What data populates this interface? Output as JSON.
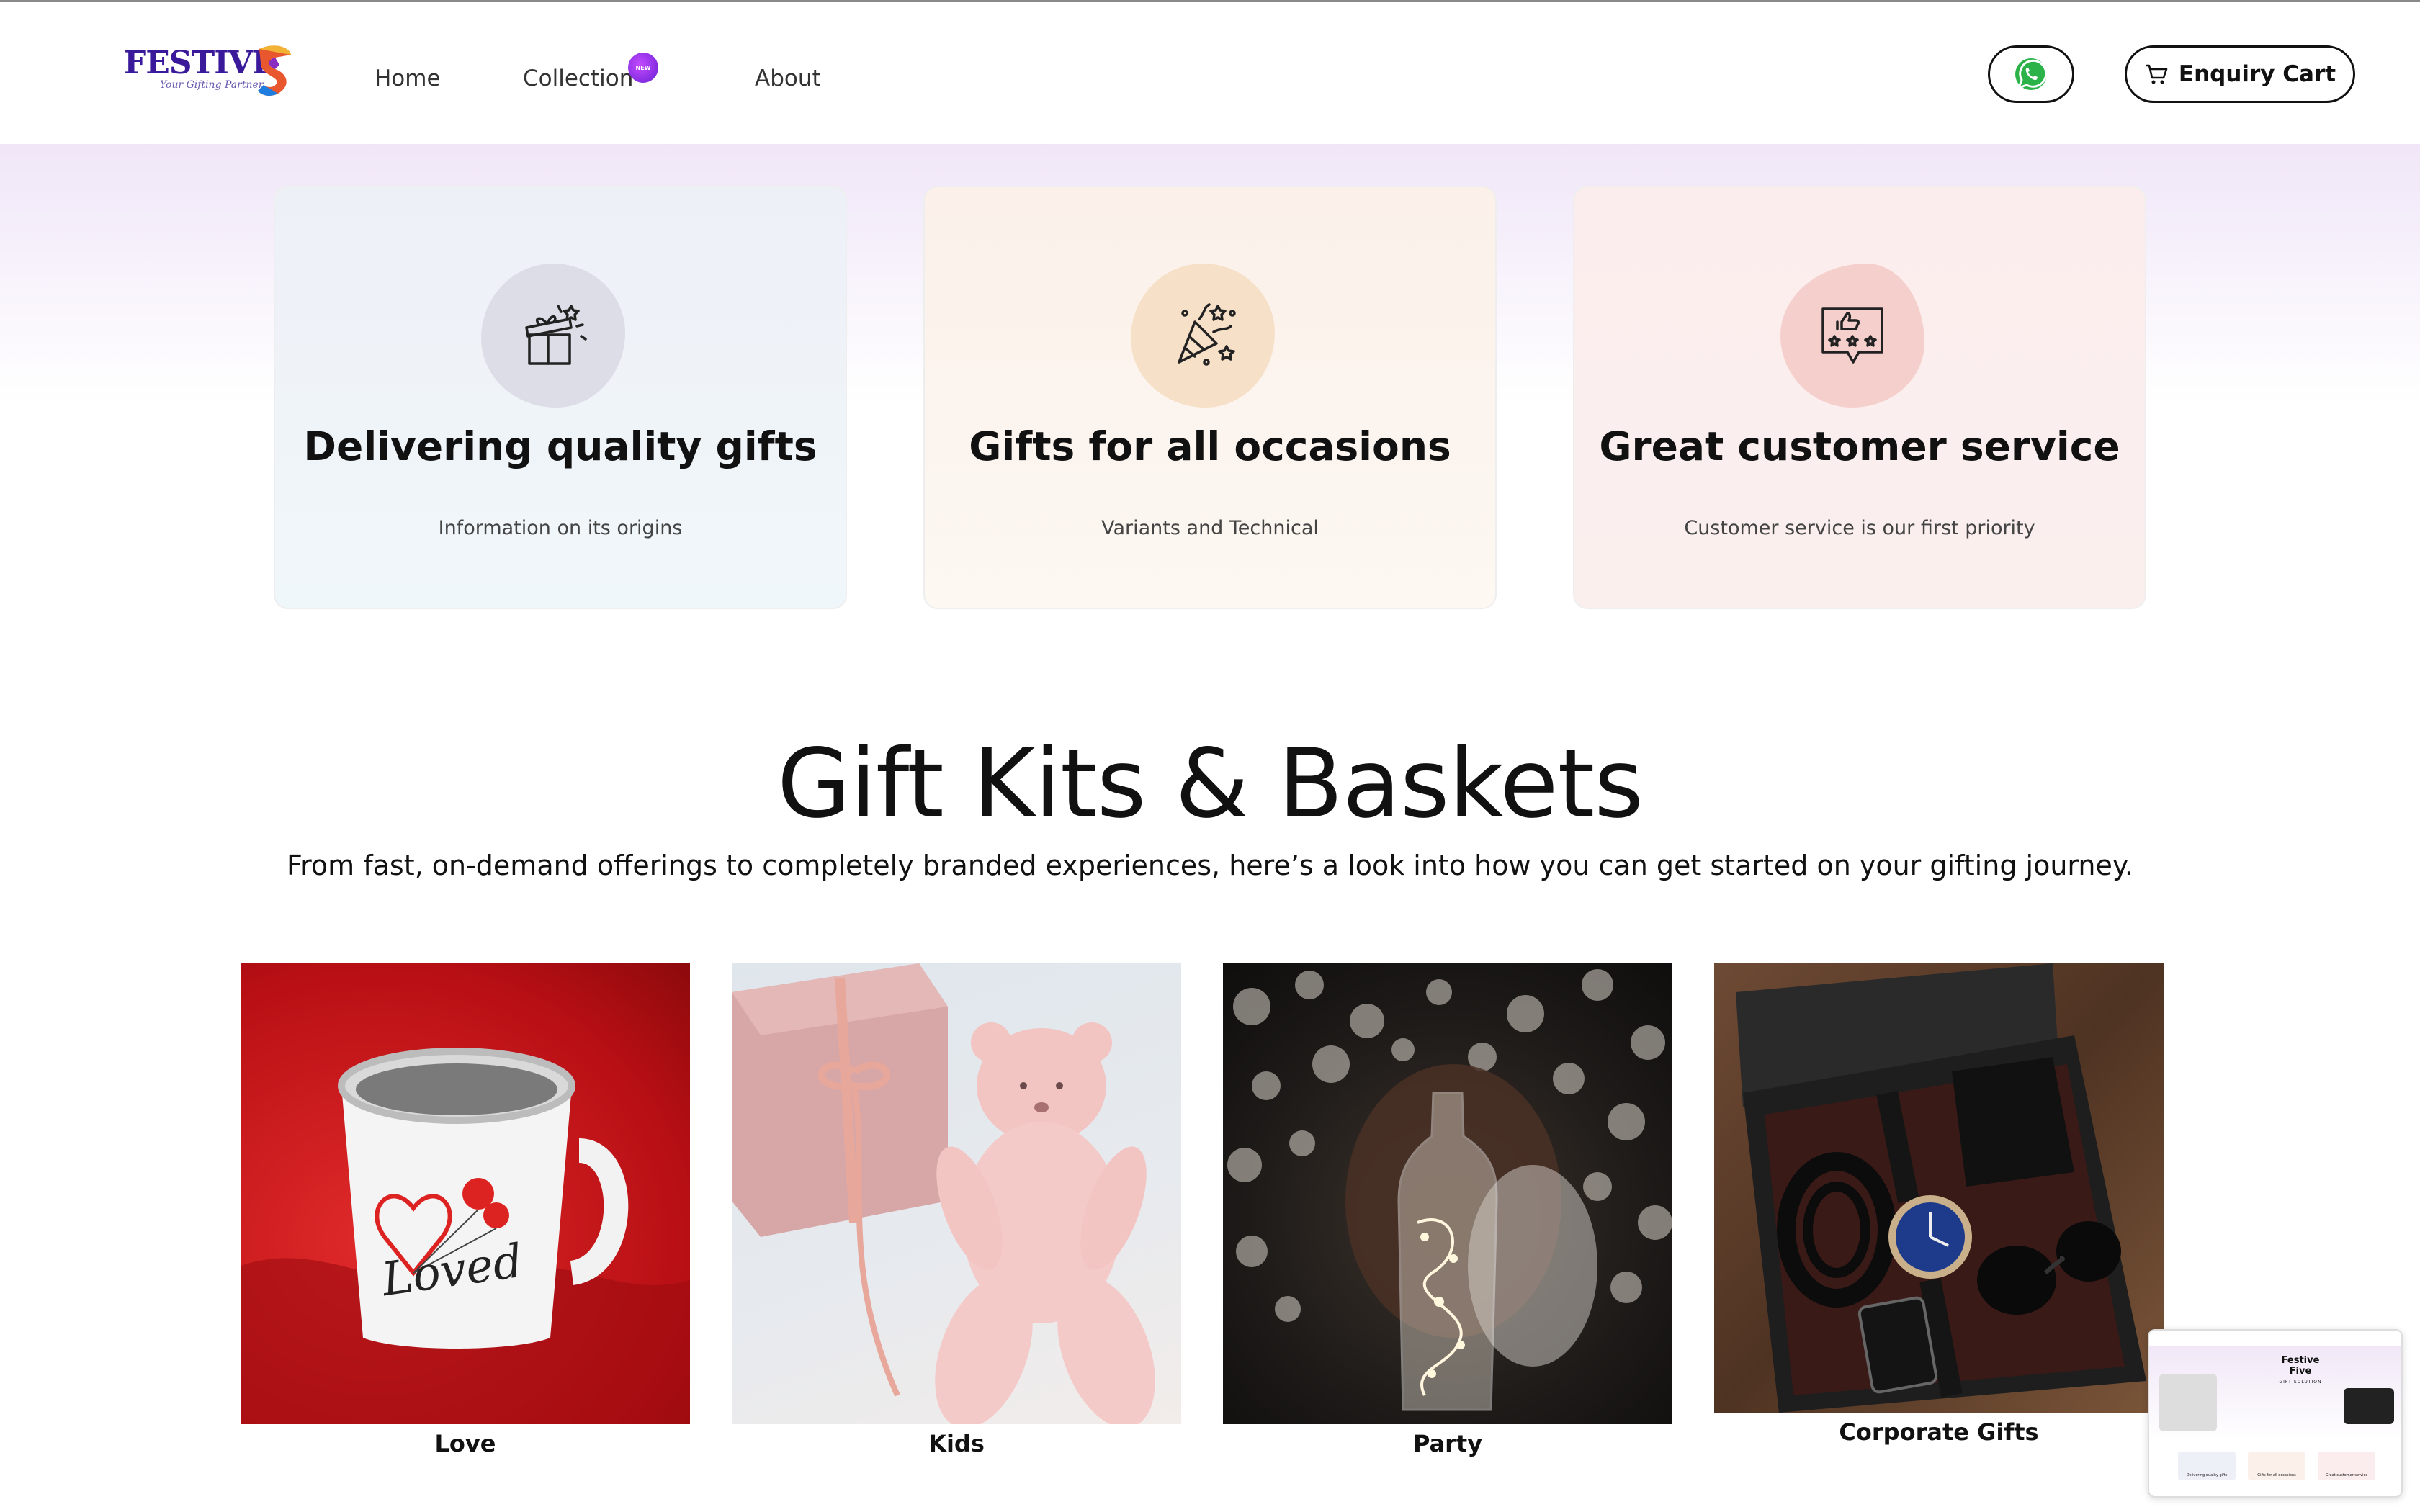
{
  "brand": {
    "name": "FESTIVE",
    "tagline": "Your Gifting Partner",
    "accent": "#3a1a9a"
  },
  "nav": {
    "items": [
      {
        "label": "Home"
      },
      {
        "label": "Collection",
        "badge": "NEW"
      },
      {
        "label": "About"
      }
    ]
  },
  "header_actions": {
    "whatsapp_icon": "whatsapp-icon",
    "cart_icon": "cart-icon",
    "cart_label": "Enquiry Cart"
  },
  "features": [
    {
      "icon": "gift-box-icon",
      "title": "Delivering quality gifts",
      "subtitle": "Information on its origins",
      "blob_color": "#dcdde6"
    },
    {
      "icon": "party-popper-icon",
      "title": "Gifts for all occasions",
      "subtitle": "Variants and Technical",
      "blob_color": "#f7e0c8"
    },
    {
      "icon": "rating-feedback-icon",
      "title": "Great customer service",
      "subtitle": "Customer service is our first priority",
      "blob_color": "#f5cfcc"
    }
  ],
  "section": {
    "title": "Gift Kits & Baskets",
    "subtitle": "From fast, on-demand offerings to completely branded experiences, here’s a look into how you can get started on your gifting journey."
  },
  "products": [
    {
      "label": "Love",
      "image_text": "Loved"
    },
    {
      "label": "Kids"
    },
    {
      "label": "Party"
    },
    {
      "label": "Corporate Gifts"
    }
  ],
  "preview": {
    "heading_line1": "Festive",
    "heading_line2": "Five",
    "heading_line3": "GIFT SOLUTION",
    "features": [
      "Delivering quality gifts",
      "Gifts for all occasions",
      "Great customer service"
    ]
  }
}
